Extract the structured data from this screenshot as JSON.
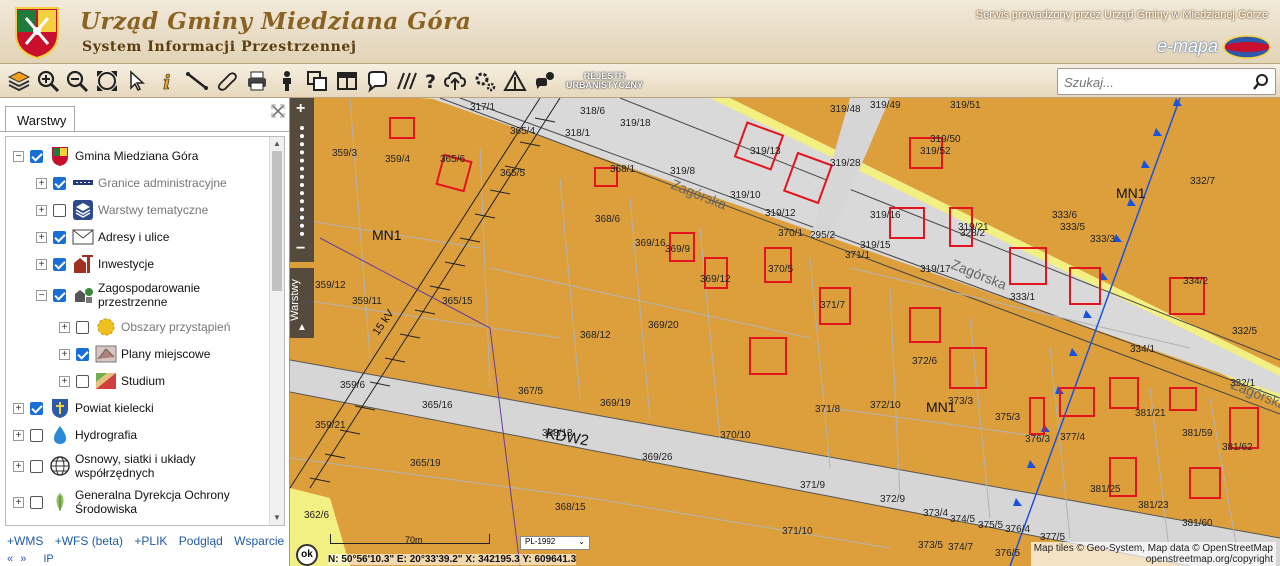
{
  "header": {
    "title": "Urząd Gminy Miedziana Góra",
    "subtitle": "System Informacji Przestrzennej",
    "service_note": "Serwis prowadzony przez Urząd Gminy w Miedzianej Górze",
    "brand": "e-mapa"
  },
  "toolbar": {
    "rejestr_line1": "REJESTR",
    "rejestr_line2": "URBANISTYCZNY",
    "search_placeholder": "Szukaj..."
  },
  "panel": {
    "tab": "Warstwy",
    "layers": [
      {
        "label": "Gmina Miedziana Góra",
        "checked": true
      },
      {
        "label": "Granice administracyjne",
        "checked": true
      },
      {
        "label": "Warstwy tematyczne",
        "checked": false
      },
      {
        "label": "Adresy i ulice",
        "checked": true
      },
      {
        "label": "Inwestycje",
        "checked": true
      },
      {
        "label": "Zagospodarowanie przestrzenne",
        "checked": true
      },
      {
        "label": "Obszary przystąpień",
        "checked": false
      },
      {
        "label": "Plany miejscowe",
        "checked": true
      },
      {
        "label": "Studium",
        "checked": false
      },
      {
        "label": "Powiat kielecki",
        "checked": true
      },
      {
        "label": "Hydrografia",
        "checked": false
      },
      {
        "label": "Osnowy, siatki i układy współrzędnych",
        "checked": false
      },
      {
        "label": "Generalna Dyrekcja Ochrony Środowiska",
        "checked": false
      }
    ],
    "links": [
      "+WMS",
      "+WFS (beta)",
      "+PLIK",
      "Podgląd",
      "Wsparcie"
    ],
    "nav": [
      "«",
      "»",
      "IP"
    ]
  },
  "map": {
    "side_tab": "Warstwy",
    "ok": "ok",
    "scale": "70m",
    "crs": "PL-1992",
    "coords": "N: 50°56'10.3\"  E: 20°33'39.2\"  X: 342195.3   Y: 609641.3",
    "attribution1": "Map tiles © Geo-System, Map data © OpenStreetMap",
    "attribution2": "openstreetmap.org/copyright",
    "zone_labels": [
      "MN1",
      "MN1",
      "MN1",
      "KDW2"
    ],
    "street_labels": [
      "Zagórska",
      "Zagórska",
      "Zagórska",
      "15 kV"
    ],
    "parcels": [
      "317/1",
      "318/6",
      "319/18",
      "319/48",
      "319/49",
      "319/51",
      "365/4",
      "318/1",
      "319/50",
      "359/3",
      "359/4",
      "365/6",
      "319/13",
      "319/28",
      "319/52",
      "365/5",
      "368/1",
      "319/8",
      "319/10",
      "332/7",
      "368/6",
      "319/12",
      "319/16",
      "319/21",
      "333/6",
      "333/5",
      "333/3",
      "370/1",
      "295/2",
      "328/2",
      "369/16",
      "369/9",
      "319/15",
      "371/1",
      "369/12",
      "370/5",
      "319/17",
      "334/2",
      "359/12",
      "359/11",
      "365/15",
      "371/7",
      "333/1",
      "369/20",
      "368/12",
      "372/6",
      "334/1",
      "332/5",
      "359/6",
      "367/5",
      "371/8",
      "372/10",
      "373/3",
      "375/3",
      "381/21",
      "332/1",
      "365/16",
      "369/19",
      "377/4",
      "376/3",
      "381/59",
      "381/62",
      "359/21",
      "368/13",
      "370/10",
      "365/19",
      "369/26",
      "371/9",
      "381/25",
      "362/6",
      "368/15",
      "372/9",
      "373/4",
      "374/5",
      "375/5",
      "376/4",
      "377/5",
      "381/23",
      "381/60",
      "371/10",
      "373/5",
      "374/7",
      "376/5"
    ]
  },
  "colors": {
    "zone_fill": "#dc9f3c",
    "road_yellow": "#f2ef83",
    "road_gray": "#d6d6d6",
    "building_red": "#e4141e",
    "boundary_blue": "#1a52e0"
  }
}
